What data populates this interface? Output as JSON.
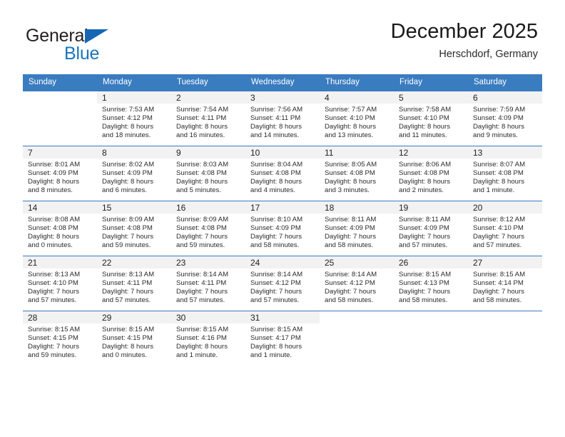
{
  "brand": {
    "name_part1": "General",
    "name_part2": "Blue",
    "triangle_color": "#1567b5",
    "blue_color": "#1a75bb"
  },
  "header": {
    "title": "December 2025",
    "subtitle": "Herschdorf, Germany"
  },
  "theme": {
    "header_row_color": "#3a7cc0",
    "daynum_band_color": "#f2f2f2",
    "text_color": "#2b2b2b"
  },
  "weekdays": [
    "Sunday",
    "Monday",
    "Tuesday",
    "Wednesday",
    "Thursday",
    "Friday",
    "Saturday"
  ],
  "weeks": [
    [
      {
        "day": "",
        "sunrise": "",
        "sunset": "",
        "daylight1": "",
        "daylight2": ""
      },
      {
        "day": "1",
        "sunrise": "Sunrise: 7:53 AM",
        "sunset": "Sunset: 4:12 PM",
        "daylight1": "Daylight: 8 hours",
        "daylight2": "and 18 minutes."
      },
      {
        "day": "2",
        "sunrise": "Sunrise: 7:54 AM",
        "sunset": "Sunset: 4:11 PM",
        "daylight1": "Daylight: 8 hours",
        "daylight2": "and 16 minutes."
      },
      {
        "day": "3",
        "sunrise": "Sunrise: 7:56 AM",
        "sunset": "Sunset: 4:11 PM",
        "daylight1": "Daylight: 8 hours",
        "daylight2": "and 14 minutes."
      },
      {
        "day": "4",
        "sunrise": "Sunrise: 7:57 AM",
        "sunset": "Sunset: 4:10 PM",
        "daylight1": "Daylight: 8 hours",
        "daylight2": "and 13 minutes."
      },
      {
        "day": "5",
        "sunrise": "Sunrise: 7:58 AM",
        "sunset": "Sunset: 4:10 PM",
        "daylight1": "Daylight: 8 hours",
        "daylight2": "and 11 minutes."
      },
      {
        "day": "6",
        "sunrise": "Sunrise: 7:59 AM",
        "sunset": "Sunset: 4:09 PM",
        "daylight1": "Daylight: 8 hours",
        "daylight2": "and 9 minutes."
      }
    ],
    [
      {
        "day": "7",
        "sunrise": "Sunrise: 8:01 AM",
        "sunset": "Sunset: 4:09 PM",
        "daylight1": "Daylight: 8 hours",
        "daylight2": "and 8 minutes."
      },
      {
        "day": "8",
        "sunrise": "Sunrise: 8:02 AM",
        "sunset": "Sunset: 4:09 PM",
        "daylight1": "Daylight: 8 hours",
        "daylight2": "and 6 minutes."
      },
      {
        "day": "9",
        "sunrise": "Sunrise: 8:03 AM",
        "sunset": "Sunset: 4:08 PM",
        "daylight1": "Daylight: 8 hours",
        "daylight2": "and 5 minutes."
      },
      {
        "day": "10",
        "sunrise": "Sunrise: 8:04 AM",
        "sunset": "Sunset: 4:08 PM",
        "daylight1": "Daylight: 8 hours",
        "daylight2": "and 4 minutes."
      },
      {
        "day": "11",
        "sunrise": "Sunrise: 8:05 AM",
        "sunset": "Sunset: 4:08 PM",
        "daylight1": "Daylight: 8 hours",
        "daylight2": "and 3 minutes."
      },
      {
        "day": "12",
        "sunrise": "Sunrise: 8:06 AM",
        "sunset": "Sunset: 4:08 PM",
        "daylight1": "Daylight: 8 hours",
        "daylight2": "and 2 minutes."
      },
      {
        "day": "13",
        "sunrise": "Sunrise: 8:07 AM",
        "sunset": "Sunset: 4:08 PM",
        "daylight1": "Daylight: 8 hours",
        "daylight2": "and 1 minute."
      }
    ],
    [
      {
        "day": "14",
        "sunrise": "Sunrise: 8:08 AM",
        "sunset": "Sunset: 4:08 PM",
        "daylight1": "Daylight: 8 hours",
        "daylight2": "and 0 minutes."
      },
      {
        "day": "15",
        "sunrise": "Sunrise: 8:09 AM",
        "sunset": "Sunset: 4:08 PM",
        "daylight1": "Daylight: 7 hours",
        "daylight2": "and 59 minutes."
      },
      {
        "day": "16",
        "sunrise": "Sunrise: 8:09 AM",
        "sunset": "Sunset: 4:08 PM",
        "daylight1": "Daylight: 7 hours",
        "daylight2": "and 59 minutes."
      },
      {
        "day": "17",
        "sunrise": "Sunrise: 8:10 AM",
        "sunset": "Sunset: 4:09 PM",
        "daylight1": "Daylight: 7 hours",
        "daylight2": "and 58 minutes."
      },
      {
        "day": "18",
        "sunrise": "Sunrise: 8:11 AM",
        "sunset": "Sunset: 4:09 PM",
        "daylight1": "Daylight: 7 hours",
        "daylight2": "and 58 minutes."
      },
      {
        "day": "19",
        "sunrise": "Sunrise: 8:11 AM",
        "sunset": "Sunset: 4:09 PM",
        "daylight1": "Daylight: 7 hours",
        "daylight2": "and 57 minutes."
      },
      {
        "day": "20",
        "sunrise": "Sunrise: 8:12 AM",
        "sunset": "Sunset: 4:10 PM",
        "daylight1": "Daylight: 7 hours",
        "daylight2": "and 57 minutes."
      }
    ],
    [
      {
        "day": "21",
        "sunrise": "Sunrise: 8:13 AM",
        "sunset": "Sunset: 4:10 PM",
        "daylight1": "Daylight: 7 hours",
        "daylight2": "and 57 minutes."
      },
      {
        "day": "22",
        "sunrise": "Sunrise: 8:13 AM",
        "sunset": "Sunset: 4:11 PM",
        "daylight1": "Daylight: 7 hours",
        "daylight2": "and 57 minutes."
      },
      {
        "day": "23",
        "sunrise": "Sunrise: 8:14 AM",
        "sunset": "Sunset: 4:11 PM",
        "daylight1": "Daylight: 7 hours",
        "daylight2": "and 57 minutes."
      },
      {
        "day": "24",
        "sunrise": "Sunrise: 8:14 AM",
        "sunset": "Sunset: 4:12 PM",
        "daylight1": "Daylight: 7 hours",
        "daylight2": "and 57 minutes."
      },
      {
        "day": "25",
        "sunrise": "Sunrise: 8:14 AM",
        "sunset": "Sunset: 4:12 PM",
        "daylight1": "Daylight: 7 hours",
        "daylight2": "and 58 minutes."
      },
      {
        "day": "26",
        "sunrise": "Sunrise: 8:15 AM",
        "sunset": "Sunset: 4:13 PM",
        "daylight1": "Daylight: 7 hours",
        "daylight2": "and 58 minutes."
      },
      {
        "day": "27",
        "sunrise": "Sunrise: 8:15 AM",
        "sunset": "Sunset: 4:14 PM",
        "daylight1": "Daylight: 7 hours",
        "daylight2": "and 58 minutes."
      }
    ],
    [
      {
        "day": "28",
        "sunrise": "Sunrise: 8:15 AM",
        "sunset": "Sunset: 4:15 PM",
        "daylight1": "Daylight: 7 hours",
        "daylight2": "and 59 minutes."
      },
      {
        "day": "29",
        "sunrise": "Sunrise: 8:15 AM",
        "sunset": "Sunset: 4:15 PM",
        "daylight1": "Daylight: 8 hours",
        "daylight2": "and 0 minutes."
      },
      {
        "day": "30",
        "sunrise": "Sunrise: 8:15 AM",
        "sunset": "Sunset: 4:16 PM",
        "daylight1": "Daylight: 8 hours",
        "daylight2": "and 1 minute."
      },
      {
        "day": "31",
        "sunrise": "Sunrise: 8:15 AM",
        "sunset": "Sunset: 4:17 PM",
        "daylight1": "Daylight: 8 hours",
        "daylight2": "and 1 minute."
      },
      {
        "day": "",
        "sunrise": "",
        "sunset": "",
        "daylight1": "",
        "daylight2": ""
      },
      {
        "day": "",
        "sunrise": "",
        "sunset": "",
        "daylight1": "",
        "daylight2": ""
      },
      {
        "day": "",
        "sunrise": "",
        "sunset": "",
        "daylight1": "",
        "daylight2": ""
      }
    ]
  ]
}
